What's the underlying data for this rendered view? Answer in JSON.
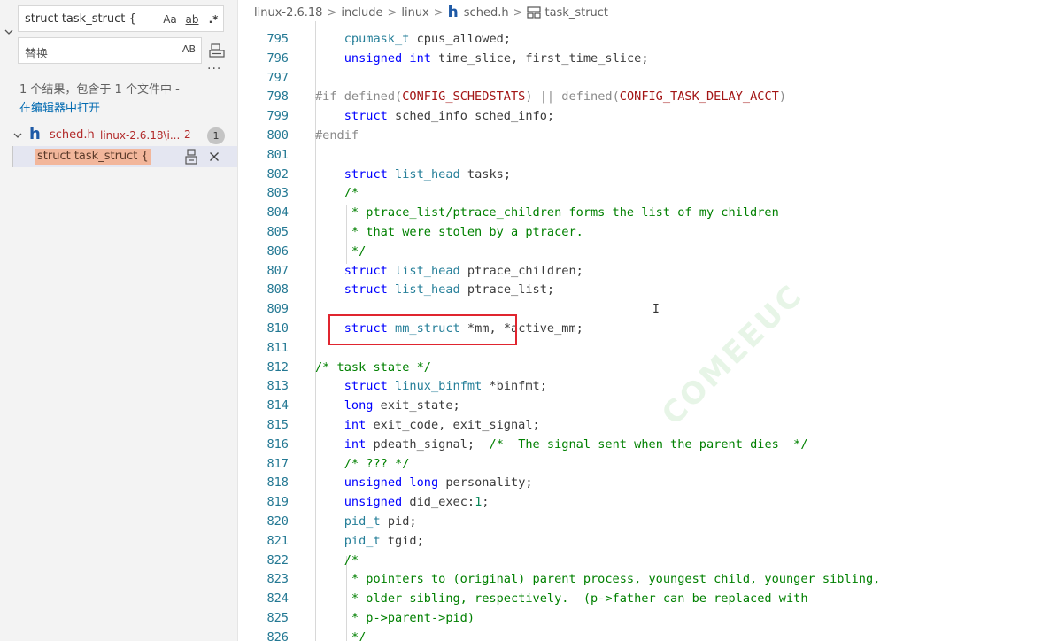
{
  "search_panel": {
    "find_value": "struct task_struct {",
    "match_case_label": "Aa",
    "whole_word_label": "ab",
    "regex_label": ".*",
    "replace_value": "替换",
    "preserve_case_label": "AB",
    "more_label": "···",
    "result_summary": "1 个结果，包含于 1 个文件中 -",
    "open_in_editor": "在编辑器中打开",
    "file": {
      "name": "sched.h",
      "path": "linux-2.6.18\\i...",
      "count_text": "2",
      "badge": "1"
    },
    "match_text": "struct task_struct {"
  },
  "breadcrumb": {
    "items": [
      "linux-2.6.18",
      "include",
      "linux",
      "sched.h",
      "task_struct"
    ]
  },
  "editor": {
    "watermark": "COMEEUC",
    "lines": [
      {
        "n": "795",
        "html": "    <span class='ty'>cpumask_t</span> cpus_allowed;"
      },
      {
        "n": "796",
        "html": "    <span class='kw'>unsigned</span> <span class='kw'>int</span> time_slice, first_time_slice;"
      },
      {
        "n": "797",
        "html": ""
      },
      {
        "n": "798",
        "html": "<span class='pp'>#if defined(</span><span class='mc'>CONFIG_SCHEDSTATS</span><span class='pp'>) || defined(</span><span class='mc'>CONFIG_TASK_DELAY_ACCT</span><span class='pp'>)</span>"
      },
      {
        "n": "799",
        "html": "    <span class='kw'>struct</span> sched_info sched_info;"
      },
      {
        "n": "800",
        "html": "<span class='pp'>#endif</span>"
      },
      {
        "n": "801",
        "html": ""
      },
      {
        "n": "802",
        "html": "    <span class='kw'>struct</span> <span class='ty'>list_head</span> tasks;"
      },
      {
        "n": "803",
        "html": "    <span class='cm'>/*</span>"
      },
      {
        "n": "804",
        "html": "<span class='cm'>     * ptrace_list/ptrace_children forms the list of my children</span>"
      },
      {
        "n": "805",
        "html": "<span class='cm'>     * that were stolen by a ptracer.</span>"
      },
      {
        "n": "806",
        "html": "<span class='cm'>     */</span>"
      },
      {
        "n": "807",
        "html": "    <span class='kw'>struct</span> <span class='ty'>list_head</span> ptrace_children;"
      },
      {
        "n": "808",
        "html": "    <span class='kw'>struct</span> <span class='ty'>list_head</span> ptrace_list;"
      },
      {
        "n": "809",
        "html": ""
      },
      {
        "n": "810",
        "html": "    <span class='kw'>struct</span> <span class='ty'>mm_struct</span> *mm, *active_mm;"
      },
      {
        "n": "811",
        "html": ""
      },
      {
        "n": "812",
        "html": "<span class='cm'>/* task state */</span>"
      },
      {
        "n": "813",
        "html": "    <span class='kw'>struct</span> <span class='ty'>linux_binfmt</span> *binfmt;"
      },
      {
        "n": "814",
        "html": "    <span class='kw'>long</span> exit_state;"
      },
      {
        "n": "815",
        "html": "    <span class='kw'>int</span> exit_code, exit_signal;"
      },
      {
        "n": "816",
        "html": "    <span class='kw'>int</span> pdeath_signal;  <span class='cm'>/*  The signal sent when the parent dies  */</span>"
      },
      {
        "n": "817",
        "html": "    <span class='cm'>/* ??? */</span>"
      },
      {
        "n": "818",
        "html": "    <span class='kw'>unsigned</span> <span class='kw'>long</span> personality;"
      },
      {
        "n": "819",
        "html": "    <span class='kw'>unsigned</span> did_exec:<span class='nm'>1</span>;"
      },
      {
        "n": "820",
        "html": "    <span class='ty'>pid_t</span> pid;"
      },
      {
        "n": "821",
        "html": "    <span class='ty'>pid_t</span> tgid;"
      },
      {
        "n": "822",
        "html": "    <span class='cm'>/*</span>"
      },
      {
        "n": "823",
        "html": "<span class='cm'>     * pointers to (original) parent process, youngest child, younger sibling,</span>"
      },
      {
        "n": "824",
        "html": "<span class='cm'>     * older sibling, respectively.  (p-&gt;father can be replaced with</span>"
      },
      {
        "n": "825",
        "html": "<span class='cm'>     * p-&gt;parent-&gt;pid)</span>"
      },
      {
        "n": "826",
        "html": "<span class='cm'>     */</span>"
      }
    ]
  }
}
